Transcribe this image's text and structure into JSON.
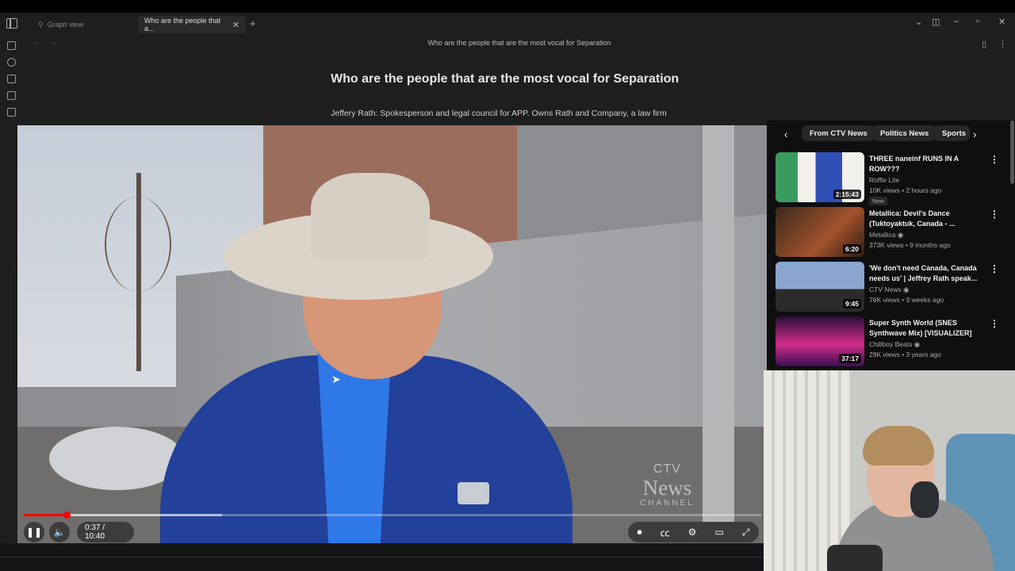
{
  "tabs": [
    {
      "label": "Graph view",
      "active": false
    },
    {
      "label": "Who are the people that a...",
      "active": true
    }
  ],
  "note": {
    "header_title": "Who are the people that are the most vocal for Separation",
    "heading": "Who are the people that are the most vocal for Separation",
    "paragraph": "Jeffery Rath: Spokesperson and legal council for APP. Owns Rath and Company, a law firm"
  },
  "player": {
    "time_display": "0:37 / 10:40",
    "progress_fraction": 0.058,
    "watermark": {
      "line1": "CTV",
      "line2": "News",
      "line3": "CHANNEL"
    }
  },
  "youtube": {
    "chips": [
      "From CTV News",
      "Politics News",
      "Sports"
    ],
    "videos": [
      {
        "title": "THREE naneinf RUNS IN A ROW???",
        "channel": "Roffle Lite",
        "meta": "10K views • 2 hours ago",
        "badge": "New",
        "duration": "2:15:43",
        "verified": false
      },
      {
        "title": "Metallica: Devil's Dance (Tuktoyaktuk, Canada - ...",
        "channel": "Metallica",
        "meta": "373K views • 9 months ago",
        "badge": "",
        "duration": "6:20",
        "verified": true
      },
      {
        "title": "'We don't need Canada, Canada needs us' | Jeffrey Rath speak...",
        "channel": "CTV News",
        "meta": "76K views • 3 weeks ago",
        "badge": "",
        "duration": "9:45",
        "verified": true
      },
      {
        "title": "Super Synth World (SNES Synthwave Mix) [VISUALIZER]",
        "channel": "Chillboy Beats",
        "meta": "29K views • 3 years ago",
        "badge": "",
        "duration": "37:17",
        "verified": true
      }
    ]
  },
  "colors": {
    "progress": "#ff0000",
    "yt_bg": "#0f0f0f",
    "app_bg": "#1e1e1e"
  }
}
